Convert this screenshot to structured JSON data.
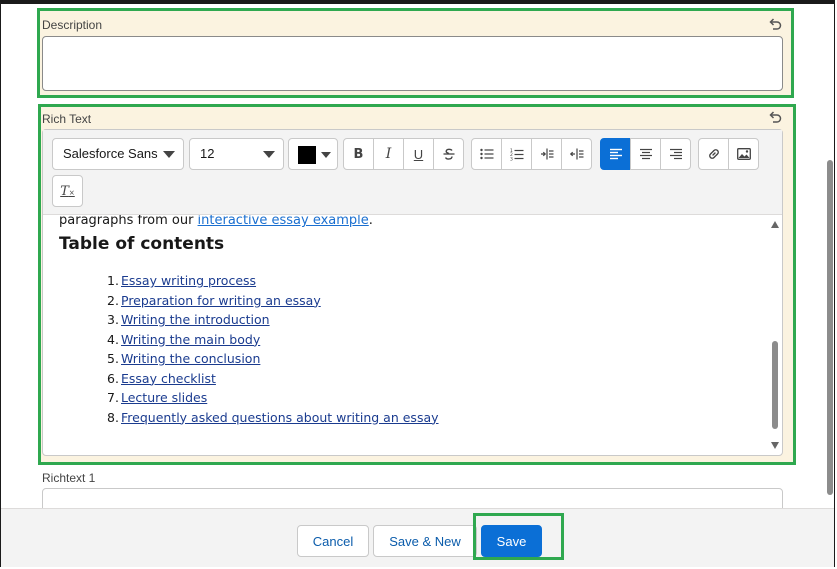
{
  "description": {
    "label": "Description",
    "value": ""
  },
  "rich_text": {
    "label": "Rich Text",
    "toolbar": {
      "font_family": "Salesforce Sans",
      "font_size": "12",
      "text_color": "#000000",
      "buttons": [
        "bold-icon",
        "italic-icon",
        "underline-icon",
        "strikethrough-icon",
        "bulleted-list-icon",
        "numbered-list-icon",
        "indent-icon",
        "outdent-icon",
        "align-left-icon",
        "align-center-icon",
        "align-right-icon",
        "link-icon",
        "image-icon",
        "clear-formatting-icon"
      ],
      "active_alignment": "left",
      "bold": "B",
      "italic": "I",
      "underline": "U",
      "clear_formatting": "T"
    },
    "content": {
      "intro_text": "paragraphs from our ",
      "intro_link": "interactive essay example",
      "intro_end": ".",
      "heading": "Table of contents",
      "toc": [
        {
          "num": "1.",
          "text": "Essay writing process"
        },
        {
          "num": "2.",
          "text": "Preparation for writing an essay"
        },
        {
          "num": "3.",
          "text": "Writing the introduction"
        },
        {
          "num": "4.",
          "text": "Writing the main body"
        },
        {
          "num": "5.",
          "text": "Writing the conclusion"
        },
        {
          "num": "6.",
          "text": "Essay checklist"
        },
        {
          "num": "7.",
          "text": "Lecture slides"
        },
        {
          "num": "8.",
          "text": "Frequently asked questions about writing an essay"
        }
      ]
    }
  },
  "richtext1": {
    "label": "Richtext 1"
  },
  "footer": {
    "cancel": "Cancel",
    "save_new": "Save & New",
    "save": "Save"
  },
  "colors": {
    "highlight": "#2fa84f",
    "brand": "#0b6fd6",
    "field_bg": "#fbf3e0"
  }
}
